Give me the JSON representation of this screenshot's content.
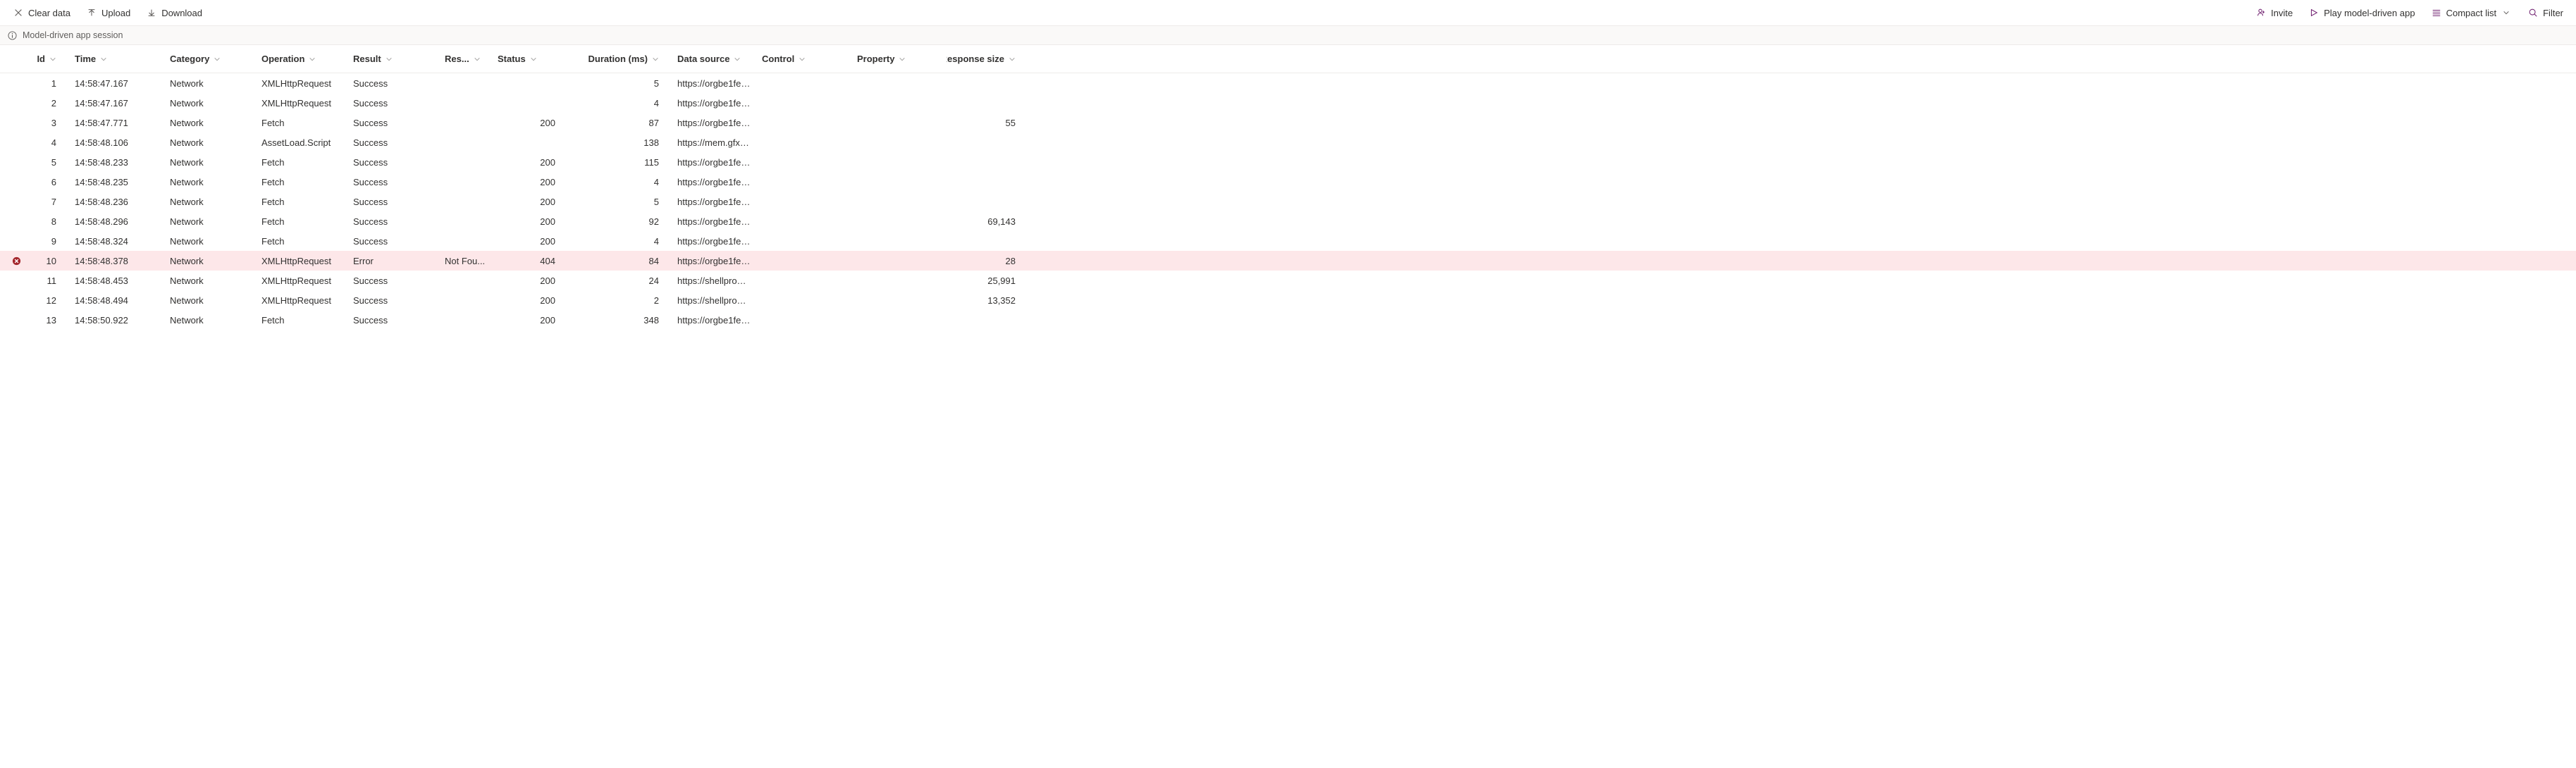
{
  "toolbar": {
    "clear_data_label": "Clear data",
    "upload_label": "Upload",
    "download_label": "Download",
    "invite_label": "Invite",
    "play_label": "Play model-driven app",
    "view_label": "Compact list",
    "filter_label": "Filter"
  },
  "session_bar": {
    "label": "Model-driven app session"
  },
  "columns": {
    "id": "Id",
    "time": "Time",
    "category": "Category",
    "operation": "Operation",
    "result": "Result",
    "respmsg": "Res...",
    "status": "Status",
    "duration": "Duration (ms)",
    "datasource": "Data source",
    "control": "Control",
    "property": "Property",
    "respsize": "Response size"
  },
  "rows": [
    {
      "id": "1",
      "time": "14:58:47.167",
      "category": "Network",
      "operation": "XMLHttpRequest",
      "result": "Success",
      "respmsg": "",
      "status": "",
      "duration": "5",
      "datasource": "https://orgbe1fed...",
      "control": "",
      "property": "",
      "respsize": "",
      "error": false
    },
    {
      "id": "2",
      "time": "14:58:47.167",
      "category": "Network",
      "operation": "XMLHttpRequest",
      "result": "Success",
      "respmsg": "",
      "status": "",
      "duration": "4",
      "datasource": "https://orgbe1fed...",
      "control": "",
      "property": "",
      "respsize": "",
      "error": false
    },
    {
      "id": "3",
      "time": "14:58:47.771",
      "category": "Network",
      "operation": "Fetch",
      "result": "Success",
      "respmsg": "",
      "status": "200",
      "duration": "87",
      "datasource": "https://orgbe1fed...",
      "control": "",
      "property": "",
      "respsize": "55",
      "error": false
    },
    {
      "id": "4",
      "time": "14:58:48.106",
      "category": "Network",
      "operation": "AssetLoad.Script",
      "result": "Success",
      "respmsg": "",
      "status": "",
      "duration": "138",
      "datasource": "https://mem.gfx.m...",
      "control": "",
      "property": "",
      "respsize": "",
      "error": false
    },
    {
      "id": "5",
      "time": "14:58:48.233",
      "category": "Network",
      "operation": "Fetch",
      "result": "Success",
      "respmsg": "",
      "status": "200",
      "duration": "115",
      "datasource": "https://orgbe1fed...",
      "control": "",
      "property": "",
      "respsize": "",
      "error": false
    },
    {
      "id": "6",
      "time": "14:58:48.235",
      "category": "Network",
      "operation": "Fetch",
      "result": "Success",
      "respmsg": "",
      "status": "200",
      "duration": "4",
      "datasource": "https://orgbe1fed...",
      "control": "",
      "property": "",
      "respsize": "",
      "error": false
    },
    {
      "id": "7",
      "time": "14:58:48.236",
      "category": "Network",
      "operation": "Fetch",
      "result": "Success",
      "respmsg": "",
      "status": "200",
      "duration": "5",
      "datasource": "https://orgbe1fed...",
      "control": "",
      "property": "",
      "respsize": "",
      "error": false
    },
    {
      "id": "8",
      "time": "14:58:48.296",
      "category": "Network",
      "operation": "Fetch",
      "result": "Success",
      "respmsg": "",
      "status": "200",
      "duration": "92",
      "datasource": "https://orgbe1fed...",
      "control": "",
      "property": "",
      "respsize": "69,143",
      "error": false
    },
    {
      "id": "9",
      "time": "14:58:48.324",
      "category": "Network",
      "operation": "Fetch",
      "result": "Success",
      "respmsg": "",
      "status": "200",
      "duration": "4",
      "datasource": "https://orgbe1fed...",
      "control": "",
      "property": "",
      "respsize": "",
      "error": false
    },
    {
      "id": "10",
      "time": "14:58:48.378",
      "category": "Network",
      "operation": "XMLHttpRequest",
      "result": "Error",
      "respmsg": "Not Fou...",
      "status": "404",
      "duration": "84",
      "datasource": "https://orgbe1fed...",
      "control": "",
      "property": "",
      "respsize": "28",
      "error": true
    },
    {
      "id": "11",
      "time": "14:58:48.453",
      "category": "Network",
      "operation": "XMLHttpRequest",
      "result": "Success",
      "respmsg": "",
      "status": "200",
      "duration": "24",
      "datasource": "https://shellprod....",
      "control": "",
      "property": "",
      "respsize": "25,991",
      "error": false
    },
    {
      "id": "12",
      "time": "14:58:48.494",
      "category": "Network",
      "operation": "XMLHttpRequest",
      "result": "Success",
      "respmsg": "",
      "status": "200",
      "duration": "2",
      "datasource": "https://shellprod....",
      "control": "",
      "property": "",
      "respsize": "13,352",
      "error": false
    },
    {
      "id": "13",
      "time": "14:58:50.922",
      "category": "Network",
      "operation": "Fetch",
      "result": "Success",
      "respmsg": "",
      "status": "200",
      "duration": "348",
      "datasource": "https://orgbe1fed...",
      "control": "",
      "property": "",
      "respsize": "",
      "error": false
    }
  ]
}
